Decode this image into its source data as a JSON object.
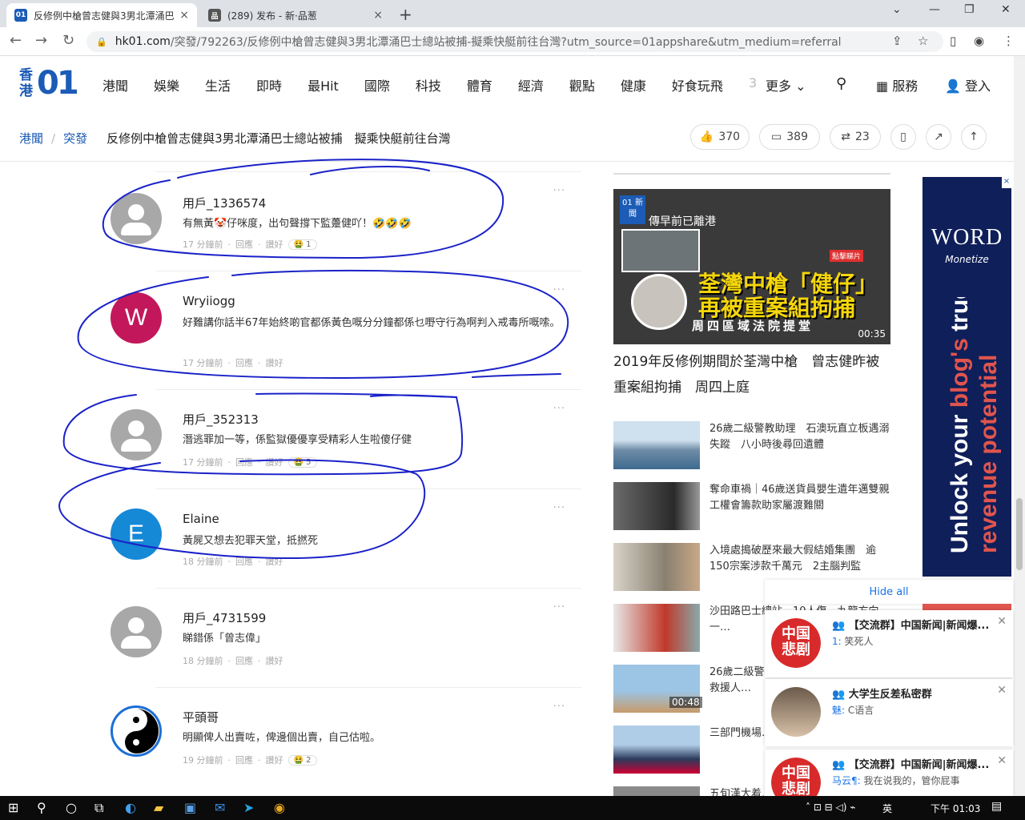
{
  "browser": {
    "tabs": [
      {
        "favicon": "01",
        "title": "反修例中槍曾志健與3男北潭涌巴",
        "close": "×"
      },
      {
        "favicon": "品",
        "title": "(289) 发布 - 新·品葱",
        "close": "×"
      }
    ],
    "new_tab": "+",
    "url_host": "hk01.com",
    "url_path": "/突發/792263/反修例中槍曾志健與3男北潭涌巴士總站被捕-擬乘快艇前往台灣?utm_source=01appshare&utm_medium=referral"
  },
  "site": {
    "logo_hk": "香港",
    "logo_01": "01",
    "nav": [
      "港聞",
      "娛樂",
      "生活",
      "即時",
      "最Hit",
      "國際",
      "科技",
      "體育",
      "經濟",
      "觀點",
      "健康",
      "好食玩飛",
      "3"
    ],
    "more": "更多",
    "services": "服務",
    "login": "登入"
  },
  "article": {
    "breadcrumb": [
      "港聞",
      "突發"
    ],
    "separator": "/",
    "title": "反修例中槍曾志健與3男北潭涌巴士總站被捕　擬乘快艇前往台灣",
    "likes": "370",
    "comments": "389",
    "shares": "23"
  },
  "comments": [
    {
      "user": "用戶_1336574",
      "text": "有無黃🤡仔咪度，出句聲撐下監躉健吖！🤣🤣🤣",
      "time": "17 分鐘前",
      "reply": "回應",
      "like": "讚好",
      "react": "🤮 1",
      "avatar": "gray"
    },
    {
      "user": "Wryiiogg",
      "text": "好難講你話半67年始終啲官都係黃色嘅分分鐘都係乜嘢守行為啊判入戒毒所嘅嗦。",
      "time": "17 分鐘前",
      "reply": "回應",
      "like": "讚好",
      "react": "",
      "avatar": "W",
      "color": "#c2185b"
    },
    {
      "user": "用戶_352313",
      "text": "潛逃罪加一等，係監獄優優享受精彩人生啦傻仔健",
      "time": "17 分鐘前",
      "reply": "回應",
      "like": "讚好",
      "react": "🤮 5",
      "avatar": "gray"
    },
    {
      "user": "Elaine",
      "text": "黃屍又想去犯罪天堂，抵撚死",
      "time": "18 分鐘前",
      "reply": "回應",
      "like": "讚好",
      "react": "",
      "avatar": "E",
      "color": "#1588d6"
    },
    {
      "user": "用戶_4731599",
      "text": "睇錯係「曾志偉」",
      "time": "18 分鐘前",
      "reply": "回應",
      "like": "讚好",
      "react": "",
      "avatar": "gray"
    },
    {
      "user": "平頭哥",
      "text": "明顯俾人出賣咗，俾邊個出賣，自己估啦。",
      "time": "19 分鐘前",
      "reply": "回應",
      "like": "讚好",
      "react": "🤮 2",
      "avatar": "yinyang"
    }
  ],
  "more_dots": "···",
  "video": {
    "badge": "01 新聞",
    "caption": "傳早前已離港",
    "click_tag": "點擊睇片",
    "headline1": "荃灣中槍「健仔」",
    "headline1b": "再被重案組拘捕",
    "headline2": "周四區域法院提堂",
    "duration": "00:35",
    "title": "2019年反修例期間於荃灣中槍　曾志健昨被重案組拘捕　周四上庭"
  },
  "news": [
    {
      "text": "26歲二級警教助理　石澳玩直立板遇溺失蹤　八小時後尋回遺體",
      "duration": ""
    },
    {
      "text": "奪命車禍｜46歲送貨員嬰生遺年邁雙親　工權會籌款助家屬渡難關",
      "duration": ""
    },
    {
      "text": "入境處搗破歷來最大假結婚集團　逾150宗案涉款千萬元　2主腦判監",
      "duration": ""
    },
    {
      "text": "沙田路巴士總站…10人傷　九龍方向一…",
      "duration": ""
    },
    {
      "text": "26歲二級警教助理石澳玩直立板疑失蹤　救援人…",
      "duration": "00:48"
    },
    {
      "text": "三部門機場…",
      "duration": ""
    },
    {
      "text": "五旬漢大着…",
      "duration": ""
    }
  ],
  "ad": {
    "close": "×",
    "brand": "WORD",
    "brand_sub": "Monetize",
    "line1a": "Unlock your ",
    "line1b": "blog's",
    "line1c": " true",
    "line2": "revenue potential"
  },
  "notifications": {
    "hide_all": "Hide all",
    "items": [
      {
        "title": "【交流群】中国新闻|新闻爆...",
        "sender": "1:",
        "message": " 笑死人",
        "logo": "中国悲剧"
      },
      {
        "title": "大学生反差私密群",
        "sender": "魅:",
        "message": " C语言",
        "logo": ""
      },
      {
        "title": "【交流群】中国新闻|新闻爆...",
        "sender": "马云¶:",
        "message": " 我在说我的，管你屁事",
        "logo": "中国悲剧"
      }
    ]
  },
  "taskbar": {
    "ime": "英",
    "time": "下午 01:03"
  },
  "colors": {
    "brand_blue": "#1c5bb6",
    "ink": "#1a22c8",
    "ad_bg": "#0f1f5a",
    "ad_accent": "#e0554d"
  }
}
